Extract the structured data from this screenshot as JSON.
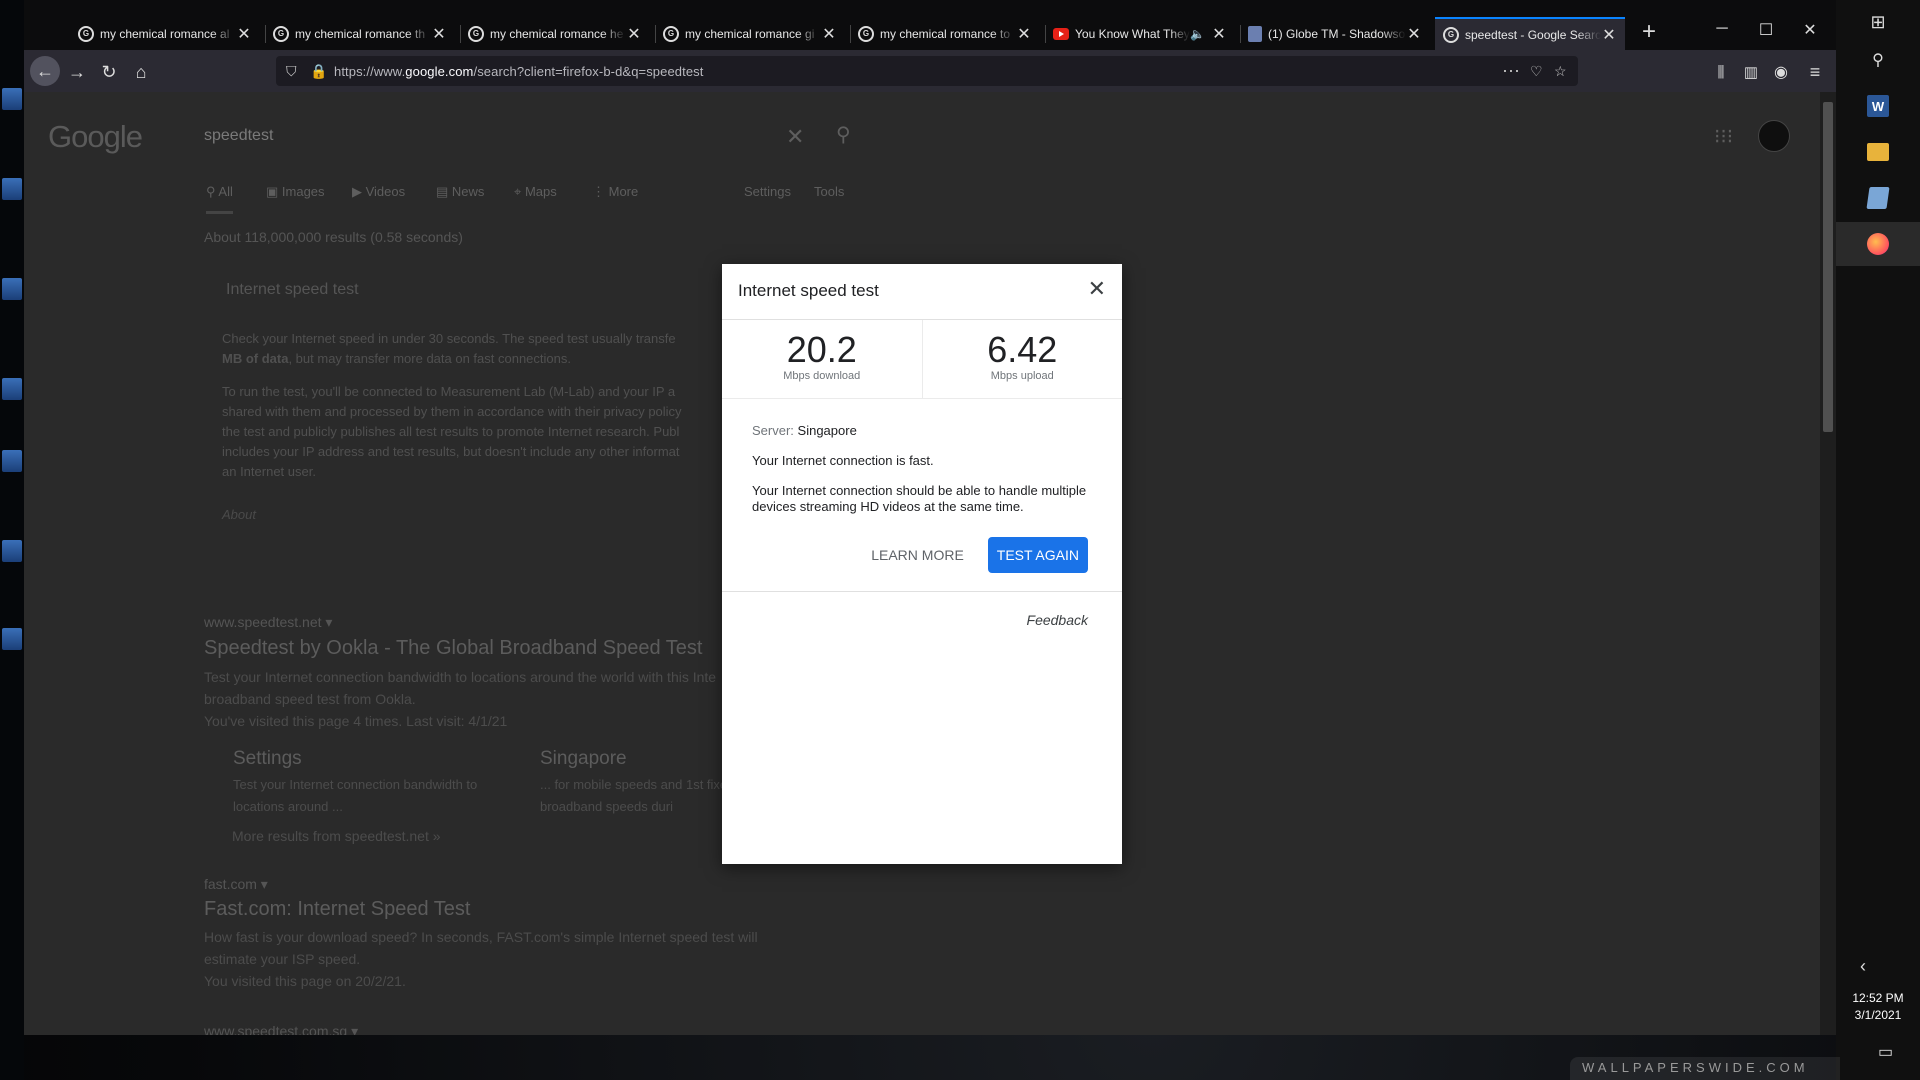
{
  "browser": {
    "tabs": [
      {
        "label": "my chemical romance al",
        "favicon": "google-icon"
      },
      {
        "label": "my chemical romance th",
        "favicon": "google-icon"
      },
      {
        "label": "my chemical romance he",
        "favicon": "google-icon"
      },
      {
        "label": "my chemical romance gi",
        "favicon": "google-icon"
      },
      {
        "label": "my chemical romance to",
        "favicon": "google-icon"
      },
      {
        "label": "You Know What They",
        "favicon": "youtube-icon"
      },
      {
        "label": "(1) Globe TM - Shadowso",
        "favicon": "shield-icon"
      },
      {
        "label": "speedtest - Google Search",
        "favicon": "google-icon",
        "active": true
      }
    ],
    "url_prefix": "https://www.",
    "url_domain": "google.com",
    "url_rest": "/search?client=firefox-b-d&q=speedtest"
  },
  "google": {
    "logo": "Google",
    "query": "speedtest",
    "tabs": [
      "All",
      "Images",
      "Videos",
      "News",
      "Maps",
      "More",
      "Settings",
      "Tools"
    ],
    "stats": "About 118,000,000 results (0.58 seconds)",
    "card_title": "Internet speed test",
    "card_p1a": "Check your Internet speed in under 30 seconds. The speed test usually transfe",
    "card_p1b": "MB of data",
    "card_p1c": ", but may transfer more data on fast connections.",
    "card_p2_lines": [
      "To run the test, you'll be connected to Measurement Lab (M-Lab) and your IP a",
      "shared with them and processed by them in accordance with their privacy policy",
      "the test and publicly publishes all test results to promote Internet research. Publ",
      "includes your IP address and test results, but doesn't include any other informat",
      "an Internet user."
    ],
    "card_about": "About",
    "results": [
      {
        "url": "www.speedtest.net",
        "title": "Speedtest by Ookla - The Global Broadband Speed Test",
        "snippet_lines": [
          "Test your Internet connection bandwidth to locations around the world with this Inte",
          "broadband speed test from Ookla.",
          "You've visited this page 4 times. Last visit: 4/1/21"
        ]
      },
      {
        "url": "fast.com",
        "title": "Fast.com: Internet Speed Test",
        "snippet_lines": [
          "How fast is your download speed? In seconds, FAST.com's simple Internet speed test will",
          "estimate your ISP speed.",
          "You visited this page on 20/2/21."
        ]
      },
      {
        "url": "www.speedtest.com.sg"
      }
    ],
    "sitelinks": [
      {
        "title": "Settings",
        "desc": "Test your Internet connection bandwidth to locations around ..."
      },
      {
        "title": "Singapore",
        "desc": "... for mobile speeds and 1st fixed broadband speeds duri"
      }
    ],
    "more_results": "More results from speedtest.net »"
  },
  "modal": {
    "title": "Internet speed test",
    "download_value": "20.2",
    "download_label": "Mbps download",
    "upload_value": "6.42",
    "upload_label": "Mbps upload",
    "server_label": "Server:",
    "server_value": "Singapore",
    "status": "Your Internet connection is fast.",
    "description": "Your Internet connection should be able to handle multiple devices streaming HD videos at the same time.",
    "learn_more": "LEARN MORE",
    "test_again": "TEST AGAIN",
    "feedback": "Feedback"
  },
  "taskbar": {
    "time": "12:52 PM",
    "date": "3/1/2021",
    "word_letter": "W"
  },
  "watermark": "WALLPAPERSWIDE.COM",
  "colors": {
    "accent": "#1a73e8",
    "firefox_tab_line": "#0a84ff"
  }
}
